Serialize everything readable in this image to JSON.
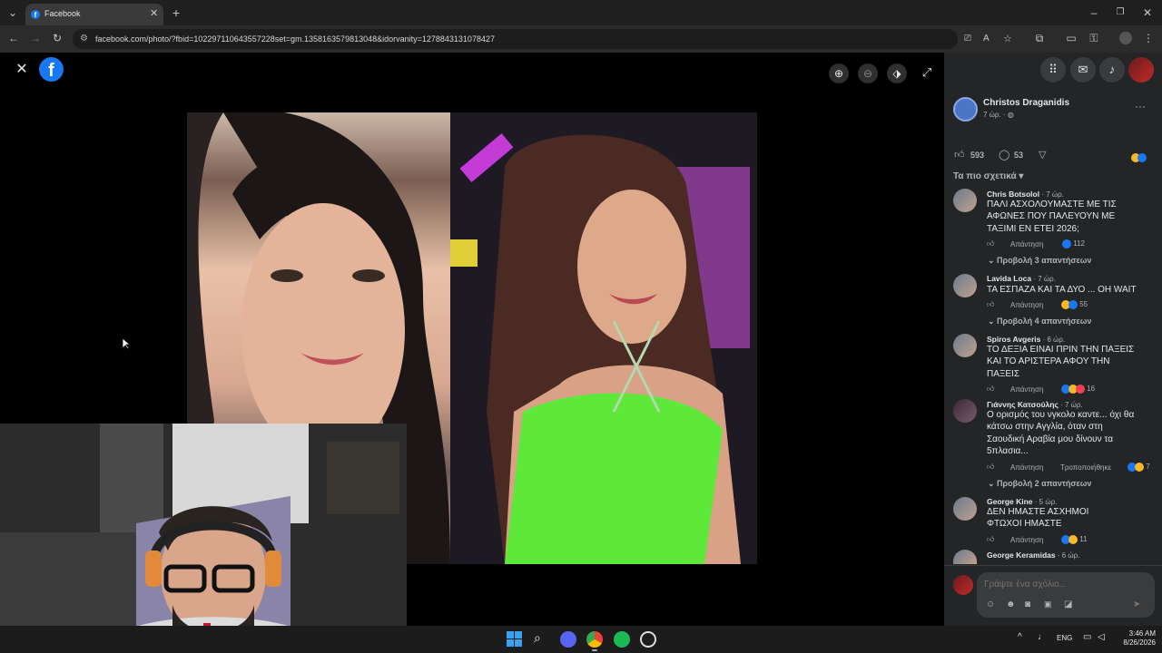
{
  "browser": {
    "tab_title": "Facebook",
    "url": "facebook.com/photo/?fbid=102297110643557228set=gm.1358163579813048&idorvanity=1278843131078427"
  },
  "post": {
    "author": "Christos Draganidis",
    "time": "7 ώρ. · ",
    "likes": "593",
    "comments_count": "53",
    "sort_label": "Τα πιο σχετικά"
  },
  "comments": [
    {
      "name": "Chris Botsolol",
      "time": " · 7 ώρ.",
      "text": "ΠΑΛΙ ΑΣΧΟΛΟΥΜΑΣΤΕ ΜΕ ΤΙΣ ΑΦΩΝΕΣ ΠΟΥ ΠΑΛΕΥΟΥΝ ΜΕ ΤΑΞΙΜΙ ΕΝ ΕΤΕΙ 2026;",
      "reply_label": "Απάντηση",
      "reactions": "112",
      "replies": "Προβολή 3 απαντήσεων"
    },
    {
      "name": "Lavida Loca",
      "time": " · 7 ώρ.",
      "text": "ΤΑ ΕΣΠΑΖΑ ΚΑΙ ΤΑ ΔΥΟ ... OH WAIT",
      "reply_label": "Απάντηση",
      "reactions": "55",
      "replies": "Προβολή 4 απαντήσεων"
    },
    {
      "name": "Spiros Avgeris",
      "time": " · 6 ώρ.",
      "text": "ΤΟ ΔΕΞΙΑ ΕΙΝΑΙ ΠΡΙΝ ΤΗΝ ΠΑΞΕΙΣ ΚΑΙ ΤΟ ΑΡΙΣΤΕΡΑ ΑΦΟΥ ΤΗΝ ΠΑΞΕΙΣ",
      "reply_label": "Απάντηση",
      "reactions": "16"
    },
    {
      "name": "Γιάννης Κατσούλης",
      "time": " · 7 ώρ.",
      "text": "Ο ορισμός του νγκολο καντε... όχι θα κάτσω στην Αγγλία, όταν στη Σαουδική Αραβία μου δίνουν τα 5πλασια...",
      "reply_label": "Απάντηση",
      "edited": "Τροποποιήθηκε",
      "reactions": "7",
      "replies": "Προβολή 2 απαντήσεων"
    },
    {
      "name": "George Kine",
      "time": " · 5 ώρ.",
      "text": "ΔΕΝ ΗΜΑΣΤΕ ΑΣΧΗΜΟΙ ΦΤΩΧΟΙ ΗΜΑΣΤΕ",
      "reply_label": "Απάντηση",
      "reactions": "11"
    },
    {
      "name": "George Keramidas",
      "time": " · 6 ώρ."
    }
  ],
  "composer": {
    "placeholder": "Γράψτε ένα σχόλιο..."
  },
  "taskbar": {
    "lang": "ENG",
    "time": "3:46 AM",
    "date": "8/26/2026"
  },
  "colors": {
    "fb_blue": "#1877f2",
    "panel_bg": "#242526",
    "neon_green": "#5de83a"
  }
}
